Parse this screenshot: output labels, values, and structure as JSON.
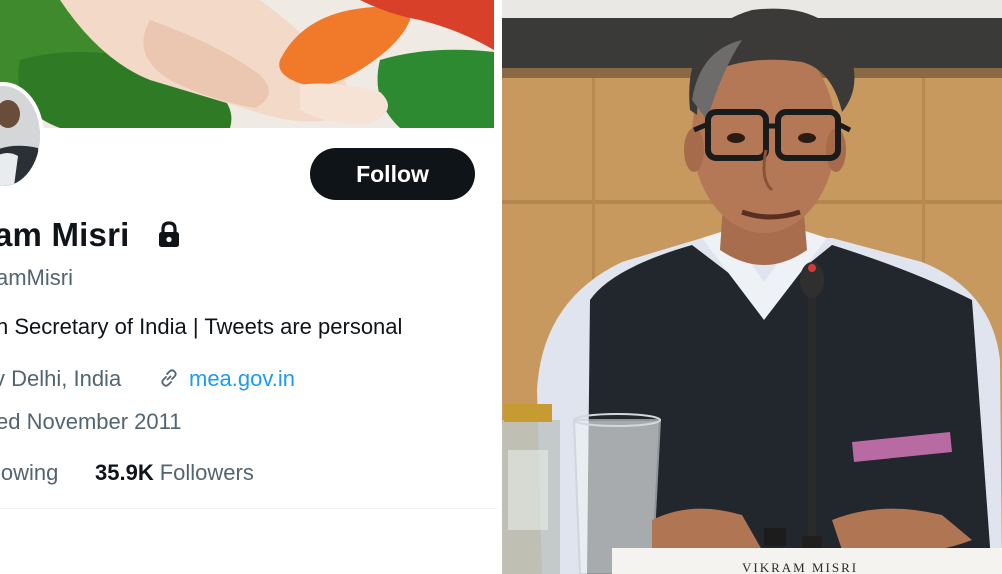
{
  "profile": {
    "display_name": "am Misri",
    "handle": "amMisri",
    "bio": "n Secretary of India | Tweets are personal",
    "location": "v Delhi, India",
    "website": "mea.gov.in",
    "joined": "ed November 2011",
    "following_label": "lowing",
    "followers_count": "35.9K",
    "followers_label": "Followers",
    "follow_button": "Follow"
  },
  "photo": {
    "nameplate_text": "VIKRAM MISRI"
  },
  "icons": {
    "lock": "lock-icon",
    "link": "link-icon"
  },
  "colors": {
    "follow_button_bg": "#0f1419",
    "link_blue": "#1d9bf0",
    "secondary_text": "#536471",
    "primary_text": "#0f1419"
  }
}
